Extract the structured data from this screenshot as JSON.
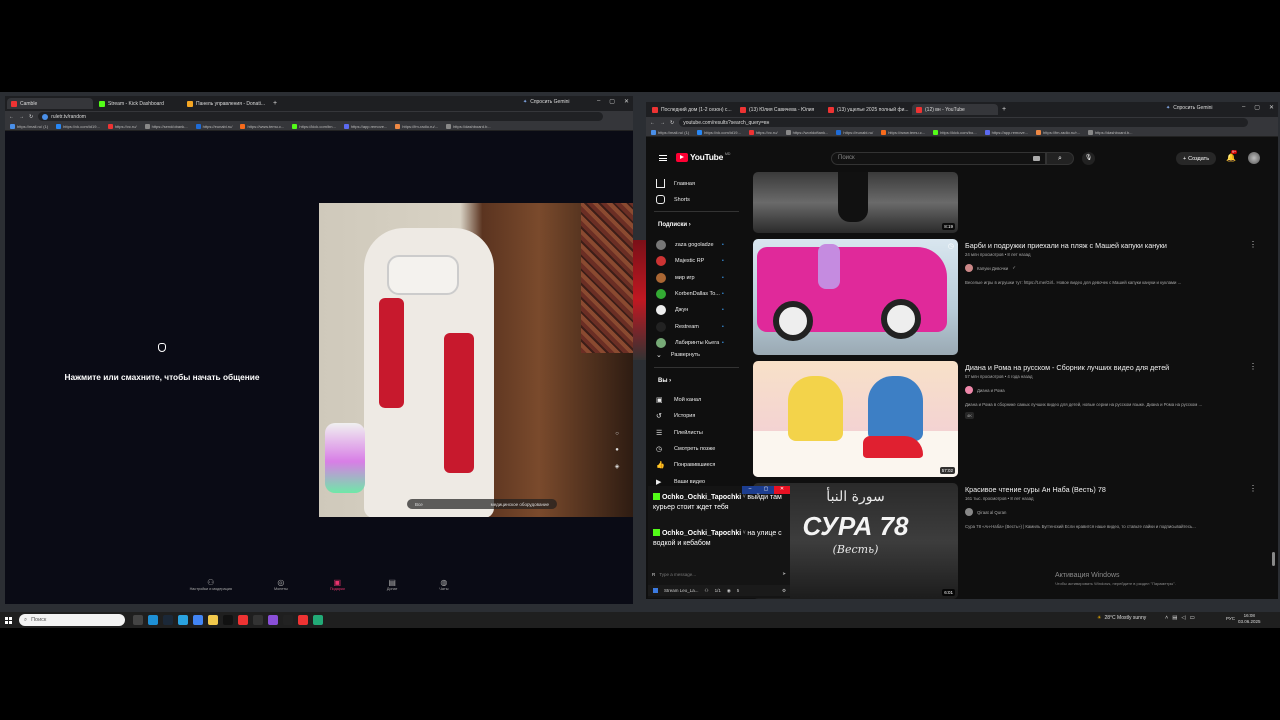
{
  "left_browser": {
    "tabs": [
      {
        "label": "Camble",
        "color": "#e33"
      },
      {
        "label": "Stream - Kick Dashboard",
        "color": "#53fc18"
      },
      {
        "label": "Панель управления - Donati...",
        "color": "#f5a623"
      }
    ],
    "gemini_button": "Спросить Gemini",
    "url": "ruletr.tv/random",
    "bookmarks": [
      "https://mail.ru/ (1)",
      "https://vk.com/id19...",
      "https://vc.ru/",
      "https://send/obank...",
      "https://eunabi.ru/",
      "https://www.temu.c...",
      "https://kick.com/bn...",
      "https://app.remove...",
      "https://fm-radio.ru/...",
      "https://dashboard.b..."
    ],
    "prompt_text": "Нажмите или смахните, чтобы начать общение",
    "video_overlay": {
      "left": "Все",
      "right": "медицинское оборудование"
    },
    "bottom_nav": [
      "Настройки и модерация",
      "Монеты",
      "Подарки",
      "Донат",
      "Чаты"
    ]
  },
  "right_browser": {
    "tabs": [
      {
        "label": "Последний дом (1-2 сезон) с...",
        "color": "#e33"
      },
      {
        "label": "(13) Юлия Савичева - Юлия",
        "color": "#e33"
      },
      {
        "label": "(13) ущелье 2025 полный фи...",
        "color": "#e33"
      },
      {
        "label": "(12) вн - YouTube",
        "color": "#e33"
      }
    ],
    "gemini_button": "Спросить Gemini",
    "url": "youtube.com/results?search_query=вн",
    "bookmarks": [
      "https://mail.ru/ (1)",
      "https://vk.com/id19...",
      "https://vc.ru/",
      "https://worldoftank...",
      "https://eunabi.ru/",
      "https://www.temu.c...",
      "https://kick.com/bo...",
      "https://app.remove...",
      "https://fm-radio.ru/r...",
      "https://dashboard.b..."
    ],
    "youtube": {
      "logo": "YouTube",
      "logo_region": "MD",
      "search_placeholder": "Поиск",
      "create_label": "Создать",
      "notif_count": "9+",
      "sidebar": {
        "main": [
          "Главная",
          "Shorts"
        ],
        "subs_header": "Подписки",
        "subs": [
          "zaza gogoladze",
          "Majestic RP",
          "мир игр",
          "KorbenDallas To...",
          "Джун",
          "Restream",
          "Лабиринты Кьега"
        ],
        "expand": "Развернуть",
        "you_header": "Вы",
        "you_items": [
          "Мой канал",
          "История",
          "Плейлисты",
          "Смотреть позже",
          "Понравившиеся",
          "Ваши видео"
        ]
      },
      "videos": [
        {
          "title": "",
          "views": "",
          "channel": "",
          "desc": "",
          "duration": "8:19"
        },
        {
          "title": "Барби и подружки приехали на пляж с Машей капуки кануки",
          "views": "24 млн просмотров • 8 лет назад",
          "channel": "Капуки Девочки",
          "desc": "Веселые игры в игрушки тут: https://t.me/Girl.. Новое видео для девочек с Машей капуки кануки и куклами ...",
          "duration": ""
        },
        {
          "title": "Диана и Рома на русском - Сборник лучших видео для детей",
          "views": "57 млн просмотров • 4 года назад",
          "channel": "Диана и Рома",
          "desc": "Диана и Рома в сборнике самых лучших видео для детей, новые серии на русском языке. Диана и Рома на русском ...",
          "badge": "4K",
          "duration": "57:02"
        },
        {
          "title": "Красивое чтение суры Ан Наба (Весть) 78",
          "views": "161 тыс. просмотров • 8 лет назад",
          "channel": "Qiraat al Quran",
          "desc": "Сура 78 «Ан-Наба» (Весть») | Камиль Бугтенский Если нравится наше видео, то ставьте лайки и подписывайтесь...",
          "thumb_arabic": "سورة النبأ",
          "thumb_title": "СУРА 78",
          "thumb_sub": "(Весть)",
          "duration": "6:01"
        }
      ]
    }
  },
  "chat_overlay": {
    "messages": [
      {
        "user": "Ochko_Ochki_Tapochki",
        "text": "выйди там курьер стоит ждет тебя"
      },
      {
        "user": "Ochko_Ochki_Tapochki",
        "text": "на улице с водкой и кебабом"
      }
    ],
    "input_placeholder": "Type a message...",
    "footer_label": "Stream Leo_La...",
    "footer_count_a": "1/1",
    "footer_count_b": "5"
  },
  "watermark": {
    "line1": "Активация Windows",
    "line2": "Чтобы активировать Windows, перейдите в раздел \"Параметры\"."
  },
  "taskbar": {
    "search_placeholder": "Поиск",
    "weather": "28°C  Mostly sunny",
    "lang": "РУС",
    "time": "16:08",
    "date": "03.06.2025"
  },
  "colors": {
    "youtube_red": "#ff0033",
    "kick_green": "#53fc18",
    "accent_pink": "#e8336d"
  }
}
